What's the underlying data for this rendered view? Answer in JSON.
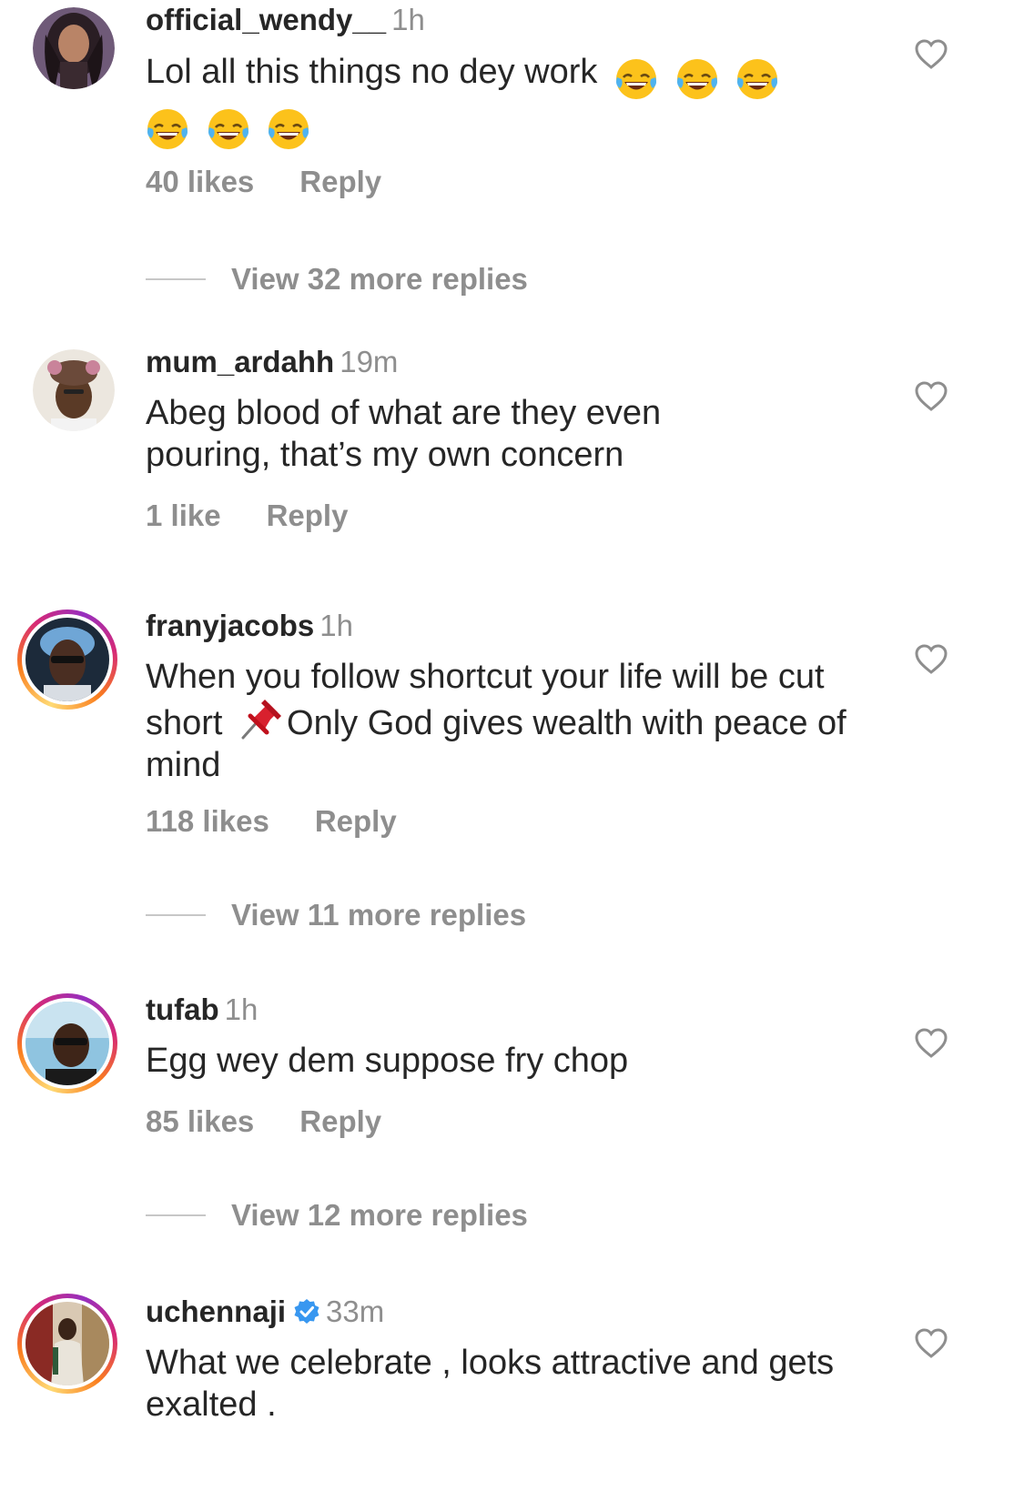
{
  "comments": [
    {
      "username": "official_wendy__",
      "time": "1h",
      "text": "Lol all this things no dey work",
      "emoji": "face-with-tears-of-joy",
      "emoji_count": 6,
      "likes": "40 likes",
      "reply": "Reply",
      "view_replies": "View 32 more replies",
      "story_ring": false,
      "verified": false
    },
    {
      "username": "mum_ardahh",
      "time": "19m",
      "text": "Abeg blood of what are they even pouring, that’s my own concern",
      "likes": "1 like",
      "reply": "Reply",
      "story_ring": false,
      "verified": false
    },
    {
      "username": "franyjacobs",
      "time": "1h",
      "text_before": "When you follow shortcut your life will be cut short",
      "emoji": "pushpin",
      "text_after": "Only God gives wealth with peace of mind",
      "likes": "118 likes",
      "reply": "Reply",
      "view_replies": "View 11 more replies",
      "story_ring": true,
      "verified": false
    },
    {
      "username": "tufab",
      "time": "1h",
      "text": "Egg wey dem suppose fry chop",
      "likes": "85 likes",
      "reply": "Reply",
      "view_replies": "View 12 more replies",
      "story_ring": true,
      "verified": false
    },
    {
      "username": "uchennaji",
      "time": "33m",
      "text": "What we celebrate , looks attractive and gets exalted .",
      "story_ring": true,
      "verified": true
    }
  ],
  "colors": {
    "text": "#262626",
    "secondary": "#8e8e8e",
    "verified": "#3897f0",
    "divider": "#c7c7c7"
  },
  "icons": {
    "like": "heart-outline-icon",
    "verified": "verified-badge-icon"
  }
}
